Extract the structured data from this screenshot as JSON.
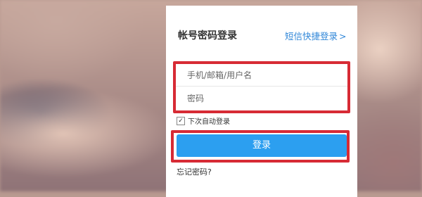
{
  "login_card": {
    "title": "帐号密码登录",
    "sms_login_link": "短信快捷登录",
    "sms_login_chevron": ">",
    "username": {
      "placeholder": "手机/邮箱/用户名",
      "value": ""
    },
    "password": {
      "placeholder": "密码",
      "value": ""
    },
    "remember_me": {
      "label": "下次自动登录",
      "checked": true,
      "check_mark": "✓"
    },
    "login_button": "登录",
    "forgot_password": "忘记密码?"
  },
  "colors": {
    "accent": "#2c9ff0",
    "link": "#2f86d8",
    "highlight_border": "#d72b35"
  },
  "icons": {
    "sms_chevron": "chevron-right-icon",
    "checkbox": "checkmark-icon"
  }
}
